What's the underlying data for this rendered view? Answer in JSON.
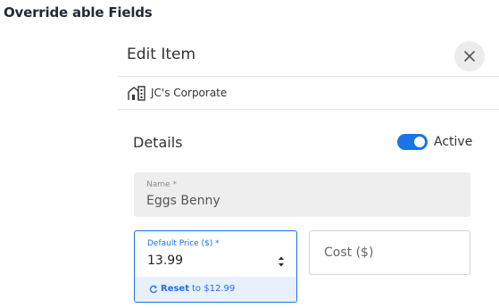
{
  "page": {
    "heading": "Override able Fields"
  },
  "panel": {
    "title": "Edit Item",
    "close_icon": "close-icon",
    "organization": {
      "icon": "building-icon",
      "name": "JC's Corporate"
    }
  },
  "details": {
    "section_title": "Details",
    "active_toggle": {
      "label": "Active",
      "on": true,
      "color": "#1a73e8"
    }
  },
  "fields": {
    "name": {
      "label": "Name *",
      "value": "Eggs Benny"
    },
    "default_price": {
      "label": "Default Price ($) *",
      "value": "13.99",
      "reset_label": "Reset",
      "reset_suffix": "to $12.99",
      "reset_icon": "refresh-icon"
    },
    "cost": {
      "placeholder": "Cost ($)"
    }
  },
  "colors": {
    "accent": "#1a73e8",
    "field_bg": "#eeeeee",
    "reset_bg": "#e8f0fd"
  }
}
